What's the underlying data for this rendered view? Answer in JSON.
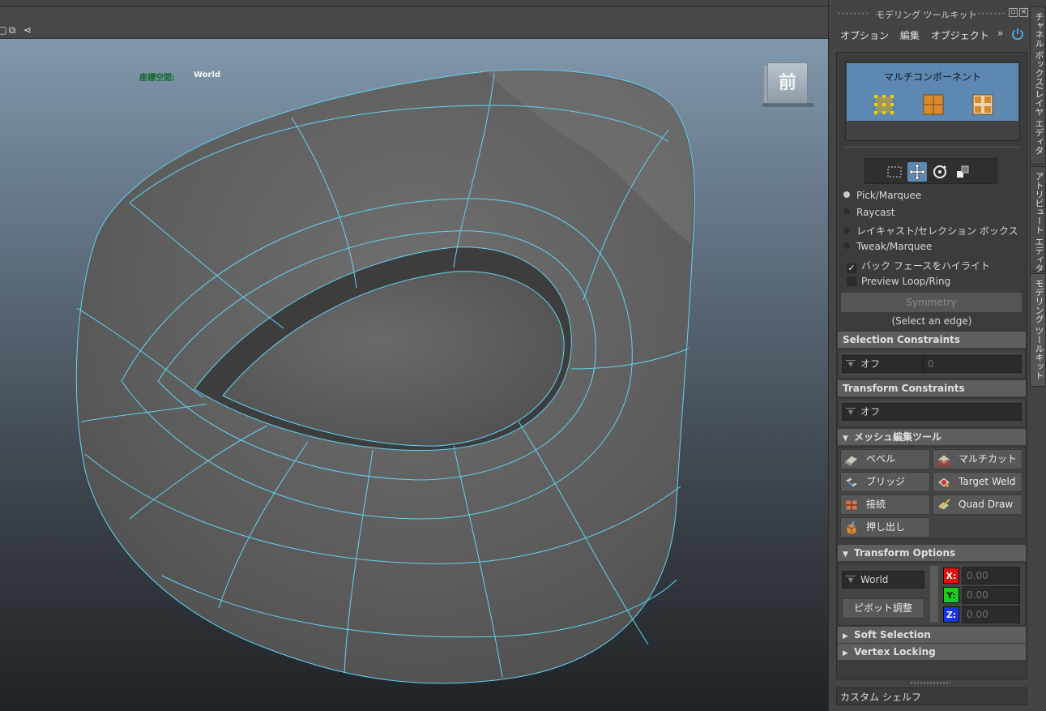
{
  "viewport": {
    "coord_label": "座標空間:",
    "coord_value": "World",
    "viewcube_face": "前",
    "wire_color": "#61d4f0"
  },
  "panel": {
    "title": "モデリング ツールキット",
    "menu": [
      "オプション",
      "編集",
      "オブジェクト"
    ],
    "menu_more": "»",
    "multi_component_label": "マルチコンポーネント",
    "selection_modes": [
      {
        "label": "Pick/Marquee",
        "selected": true
      },
      {
        "label": "Raycast",
        "selected": false
      },
      {
        "label": "レイキャスト/セレクション ボックス",
        "selected": false
      },
      {
        "label": "Tweak/Marquee",
        "selected": false
      }
    ],
    "backface_highlight": {
      "label": "バック フェースをハイライト",
      "checked": true
    },
    "preview_loop": {
      "label": "Preview Loop/Ring",
      "checked": false
    },
    "symmetry_label": "Symmetry",
    "symmetry_hint": "(Select an edge)",
    "selection_constraints": {
      "title": "Selection Constraints",
      "value": "オフ",
      "number": "0"
    },
    "transform_constraints": {
      "title": "Transform Constraints",
      "value": "オフ"
    },
    "mesh_tools": {
      "title": "メッシュ編集ツール",
      "buttons": [
        "ベベル",
        "マルチカット",
        "ブリッジ",
        "Target Weld",
        "接続",
        "Quad Draw",
        "押し出し"
      ]
    },
    "transform_options": {
      "title": "Transform Options",
      "space": "World",
      "pivot_label": "ピボット調整",
      "axes": [
        {
          "name": "X:",
          "value": "0.00",
          "color": "#e01010"
        },
        {
          "name": "Y:",
          "value": "0.00",
          "color": "#18d018"
        },
        {
          "name": "Z:",
          "value": "0.00",
          "color": "#1a34e0"
        }
      ]
    },
    "soft_selection": "Soft Selection",
    "vertex_locking": "Vertex Locking",
    "custom_shelf": "カスタム シェルフ"
  },
  "side_tabs": [
    "チャネル ボックス/レイヤ エディタ",
    "アトリビュート エディタ",
    "モデリング ツールキット"
  ]
}
